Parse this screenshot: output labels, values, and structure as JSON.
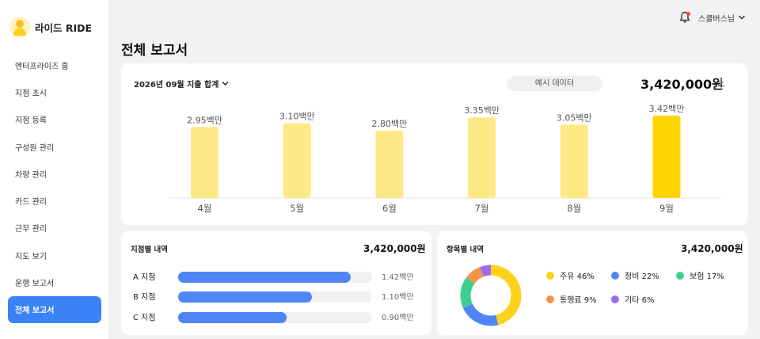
{
  "brand": {
    "name": "라이드 RIDE"
  },
  "sidebar": {
    "items": [
      {
        "label": "엔터프라이즈 홈"
      },
      {
        "label": "지점 초시"
      },
      {
        "label": "지점 등록"
      },
      {
        "label": "구성원 관리"
      },
      {
        "label": "차량 관리"
      },
      {
        "label": "카드 관리"
      },
      {
        "label": "근무 관리"
      },
      {
        "label": "지도 보기"
      },
      {
        "label": "운행 보고서"
      },
      {
        "label": "전체 보고서",
        "active": true
      }
    ]
  },
  "topbar": {
    "user_name": "스쿨버스님"
  },
  "page": {
    "title": "전체 보고서"
  },
  "summary": {
    "period_label": "2026년 09월 지출 합계",
    "sample_label": "예시 데이터",
    "total": "3,420,000원"
  },
  "chart_data": {
    "type": "bar",
    "categories": [
      "4월",
      "5월",
      "6월",
      "7월",
      "8월",
      "9월"
    ],
    "values": [
      2.95,
      3.1,
      2.8,
      3.35,
      3.05,
      3.42
    ],
    "value_labels": [
      "2.95백만",
      "3.10백만",
      "2.80백만",
      "3.35백만",
      "3.05백만",
      "3.42백만"
    ],
    "highlight_index": 5,
    "colors": {
      "normal": "#ffe986",
      "highlight": "#ffd400"
    }
  },
  "branch": {
    "title": "지점별 내역",
    "total": "3,420,000원",
    "rows": [
      {
        "name": "A 지점",
        "value": "1.42백만",
        "ratio": 0.89
      },
      {
        "name": "B 지점",
        "value": "1.10백만",
        "ratio": 0.69
      },
      {
        "name": "C 지점",
        "value": "0.90백만",
        "ratio": 0.56
      }
    ]
  },
  "category": {
    "title": "항목별 내역",
    "total": "3,420,000원",
    "items": [
      {
        "label": "주유 46%",
        "percent": 46,
        "color": "#ffd11a"
      },
      {
        "label": "정비 22%",
        "percent": 22,
        "color": "#4f86f7"
      },
      {
        "label": "보험 17%",
        "percent": 17,
        "color": "#3ecf8e"
      },
      {
        "label": "통행료 9%",
        "percent": 9,
        "color": "#f59347"
      },
      {
        "label": "기타 6%",
        "percent": 6,
        "color": "#9b6cf0"
      }
    ]
  }
}
